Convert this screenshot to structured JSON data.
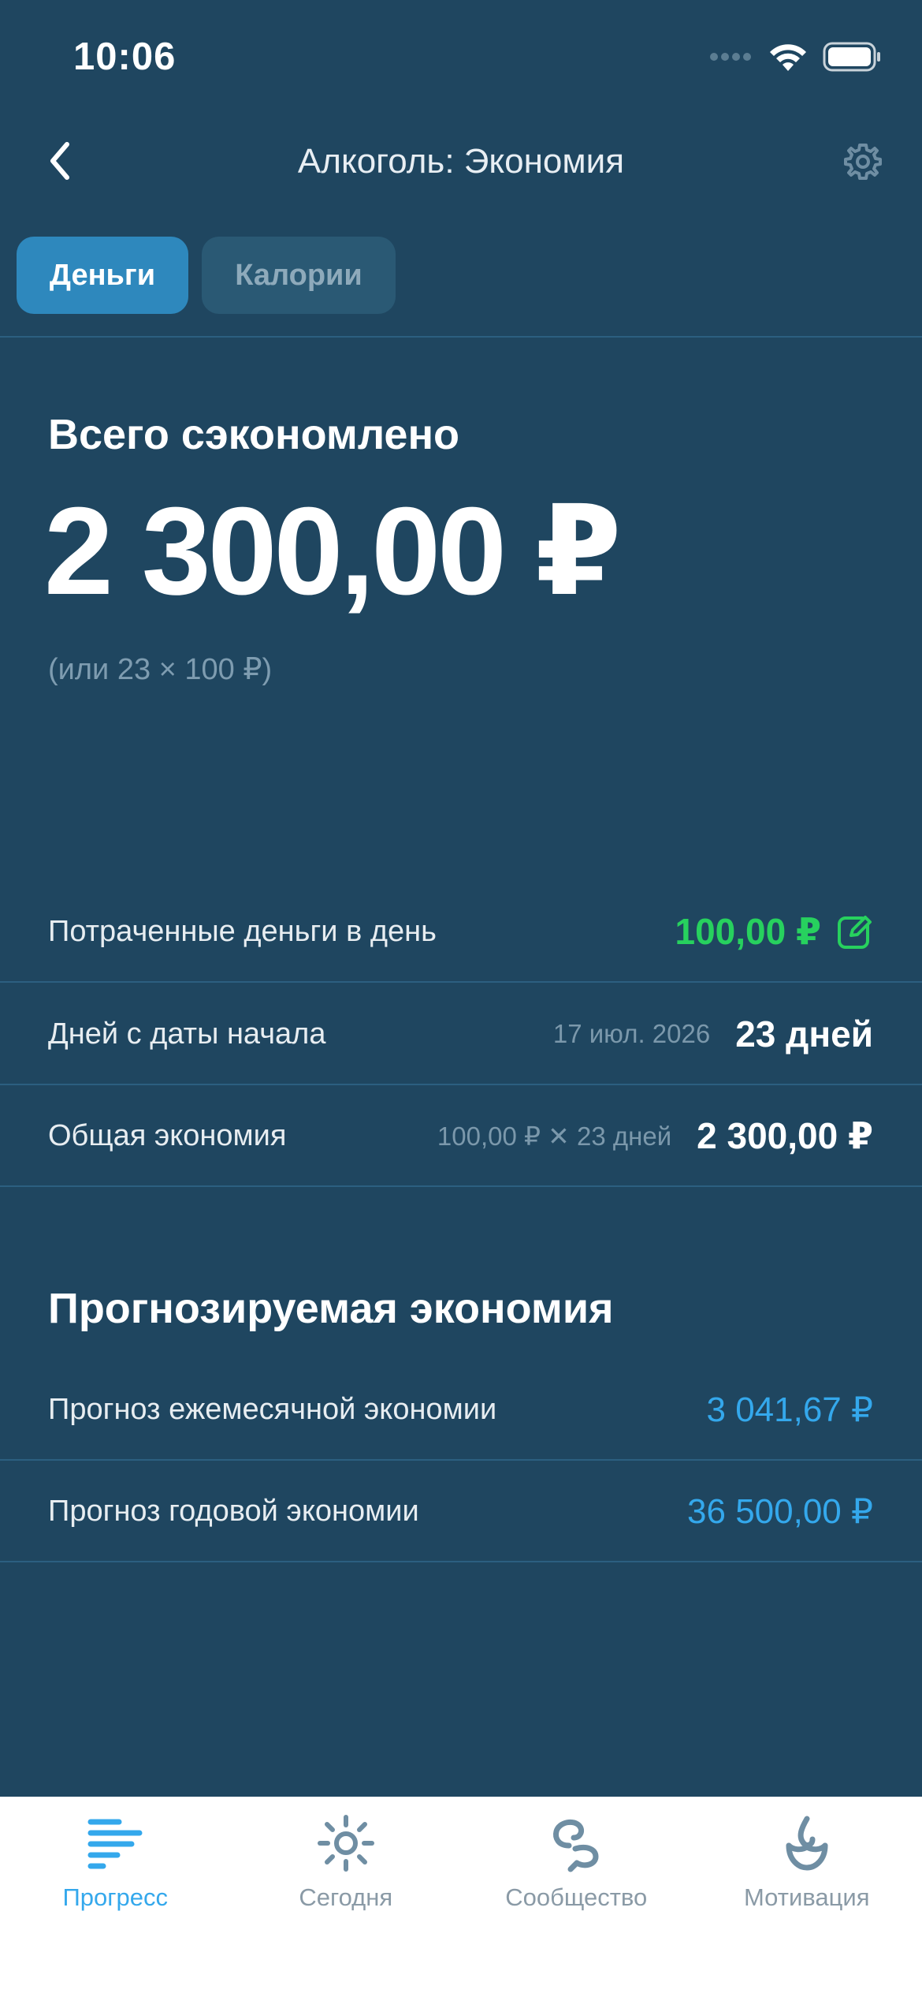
{
  "status_bar": {
    "time": "10:06"
  },
  "nav": {
    "title": "Алкоголь: Экономия"
  },
  "tabs": [
    {
      "label": "Деньги",
      "active": true
    },
    {
      "label": "Калории",
      "active": false
    }
  ],
  "summary": {
    "label": "Всего сэкономлено",
    "amount": "2 300,00 ₽",
    "breakdown": "(или 23 × 100 ₽)"
  },
  "details": {
    "daily_spend": {
      "label": "Потраченные деньги в день",
      "value": "100,00 ₽"
    },
    "days_since_start": {
      "label": "Дней с даты начала",
      "meta": "17 июл. 2026",
      "value": "23 дней"
    },
    "total_savings": {
      "label": "Общая экономия",
      "meta": "100,00 ₽ ✕ 23 дней",
      "value": "2 300,00 ₽"
    }
  },
  "forecast": {
    "title": "Прогнозируемая экономия",
    "monthly": {
      "label": "Прогноз ежемесячной экономии",
      "value": "3 041,67 ₽"
    },
    "yearly": {
      "label": "Прогноз годовой экономии",
      "value": "36 500,00 ₽"
    }
  },
  "tabbar": [
    {
      "label": "Прогресс",
      "icon": "progress-icon",
      "active": true
    },
    {
      "label": "Сегодня",
      "icon": "sun-icon",
      "active": false
    },
    {
      "label": "Сообщество",
      "icon": "community-icon",
      "active": false
    },
    {
      "label": "Мотивация",
      "icon": "motivation-icon",
      "active": false
    }
  ],
  "colors": {
    "background": "#1f4660",
    "accent": "#2e88bd",
    "green": "#27d15e",
    "blue": "#34a8ec"
  }
}
